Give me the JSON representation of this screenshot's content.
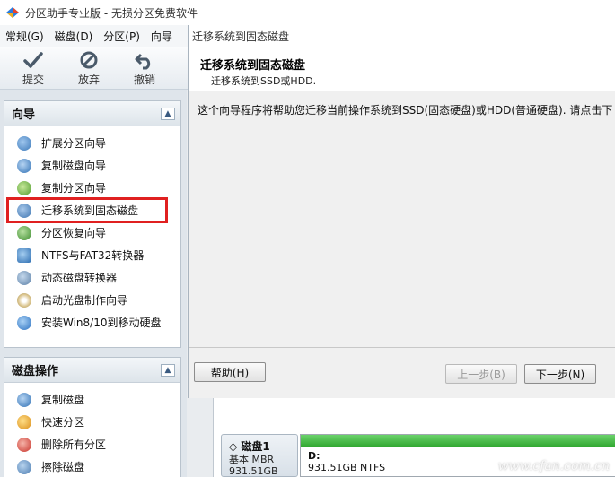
{
  "window": {
    "title": "分区助手专业版 - 无损分区免费软件"
  },
  "menu": [
    "常规(G)",
    "磁盘(D)",
    "分区(P)",
    "向导"
  ],
  "toolbar": [
    {
      "label": "提交",
      "icon": "check-icon"
    },
    {
      "label": "放弃",
      "icon": "discard-icon"
    },
    {
      "label": "撤销",
      "icon": "undo-icon"
    }
  ],
  "wizard_panel": {
    "title": "向导",
    "items": [
      {
        "label": "扩展分区向导",
        "icon": "extend-partition-icon"
      },
      {
        "label": "复制磁盘向导",
        "icon": "copy-disk-icon"
      },
      {
        "label": "复制分区向导",
        "icon": "copy-partition-icon"
      },
      {
        "label": "迁移系统到固态磁盘",
        "icon": "migrate-os-icon",
        "highlighted": true
      },
      {
        "label": "分区恢复向导",
        "icon": "recover-partition-icon"
      },
      {
        "label": "NTFS与FAT32转换器",
        "icon": "convert-fs-icon"
      },
      {
        "label": "动态磁盘转换器",
        "icon": "dynamic-disk-icon"
      },
      {
        "label": "启动光盘制作向导",
        "icon": "boot-disc-icon"
      },
      {
        "label": "安装Win8/10到移动硬盘",
        "icon": "win-to-go-icon"
      }
    ]
  },
  "disk_ops_panel": {
    "title": "磁盘操作",
    "items": [
      {
        "label": "复制磁盘",
        "icon": "copy-disk-icon"
      },
      {
        "label": "快速分区",
        "icon": "quick-partition-icon"
      },
      {
        "label": "删除所有分区",
        "icon": "delete-partitions-icon"
      },
      {
        "label": "擦除磁盘",
        "icon": "wipe-disk-icon"
      }
    ]
  },
  "dialog": {
    "title": "迁移系统到固态磁盘",
    "header_title": "迁移系统到固态磁盘",
    "header_subtitle": "迁移系统到SSD或HDD.",
    "description": "这个向导程序将帮助您迁移当前操作系统到SSD(固态硬盘)或HDD(普通硬盘). 请点击下",
    "buttons": {
      "help": "帮助(H)",
      "prev": "上一步(B)",
      "next": "下一步(N)"
    }
  },
  "disk": {
    "name": "磁盘1",
    "type": "基本 MBR",
    "size": "931.51GB",
    "partition_label": "D:",
    "partition_info": "931.51GB NTFS"
  },
  "watermark": "www.cfan.com.cn",
  "colors": {
    "highlight": "#e02020",
    "partition_bar": "#2ea52e"
  }
}
